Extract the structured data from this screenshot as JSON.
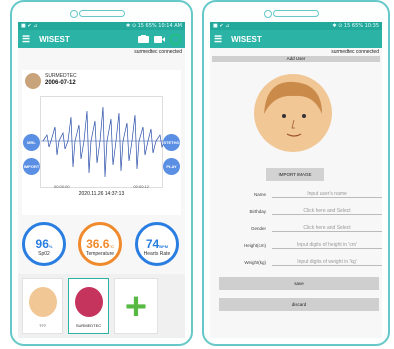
{
  "left": {
    "status": {
      "left": "■ ✔ ⊿",
      "right": "✱ ⊙ 15 65% 10:14 AM"
    },
    "appbar": {
      "title": "WISEST"
    },
    "connection": "surmedtec connected",
    "user": {
      "name": "SURMEDTEC",
      "date": "2006-07-12"
    },
    "side_buttons": {
      "mrl": "MRL",
      "import": "IMPORT",
      "stethoscope": "STETHO",
      "play": "PLAY"
    },
    "ecg_ticks": [
      "00:00:00",
      "00:00:12"
    ],
    "ecg_timestamp": "2020.11.26 14:37:13",
    "gauges": [
      {
        "value": "96",
        "unit": "%",
        "label": "Sp02",
        "color": "#2a7de1"
      },
      {
        "value": "36.6",
        "unit": "°C",
        "label": "Temperature",
        "color": "#f08a2c"
      },
      {
        "value": "74",
        "unit": "BPM",
        "label": "Hearts Rate",
        "color": "#2a7de1"
      }
    ],
    "thumbs": [
      {
        "name": "???"
      },
      {
        "name": "SURMEDTEC"
      }
    ],
    "colors": {
      "accent": "#2bb3a6",
      "add": "#57b842"
    }
  },
  "right": {
    "status": {
      "left": "■ ✔ ⊿",
      "right": "✱ ⊙ 15 65% 10:35"
    },
    "appbar": {
      "title": "WISEST"
    },
    "connection": "surmedtec connected",
    "subheader": "Add User",
    "import_label": "IMPORT IMAGE",
    "fields": [
      {
        "label": "Name",
        "placeholder": "Input user's name"
      },
      {
        "label": "Birthday",
        "placeholder": "Click here and Select"
      },
      {
        "label": "Gender",
        "placeholder": "Click here and Select"
      },
      {
        "label": "Height(cm)",
        "placeholder": "Input digits of height in 'cm'"
      },
      {
        "label": "Weight(kg)",
        "placeholder": "Input digits of weight in 'kg'"
      }
    ],
    "save_label": "save",
    "discard_label": "discard"
  }
}
